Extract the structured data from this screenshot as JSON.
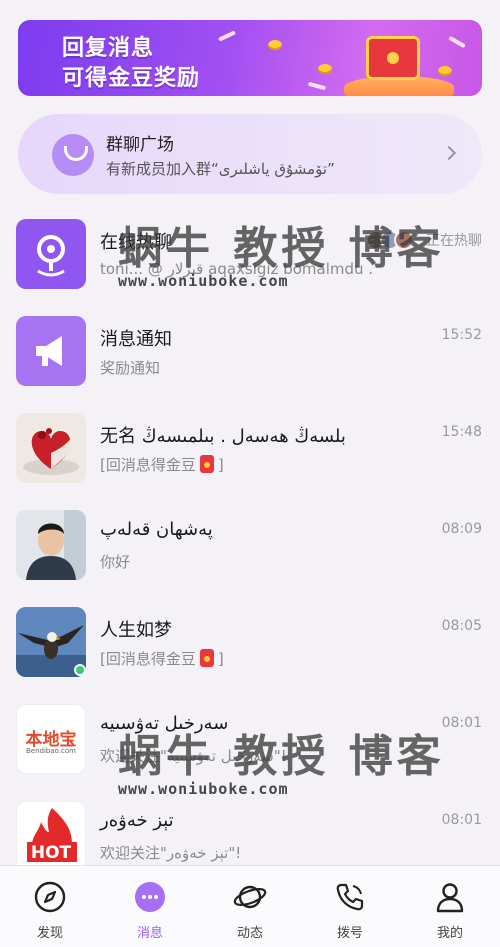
{
  "banner": {
    "line1": "回复消息",
    "line2": "可得金豆奖励"
  },
  "plaza": {
    "title": "群聊广场",
    "subtitle": "有新成员加入群“تۆمشۇق ياشلىرى”"
  },
  "chats": [
    {
      "title": "在线热聊",
      "subtitle": "toni... @ قىزلار aqaxsigiz bomalmdu .",
      "status": "正在热聊",
      "icon": "location-pin-icon",
      "color": "#8f57ef"
    },
    {
      "title": "消息通知",
      "subtitle": "奖励通知",
      "time": "15:52",
      "icon": "megaphone-icon",
      "color": "#a673f2"
    },
    {
      "title": "无名 بلسەڭ ھەسەل . بىلمىسەڭ",
      "subtitle": "[回消息得金豆",
      "subtitle_end": "]",
      "time": "15:48",
      "icon": "heart-cake-avatar"
    },
    {
      "title": "پەشھان قەلەپ",
      "subtitle": "你好",
      "time": "08:09",
      "icon": "man-portrait-avatar"
    },
    {
      "title": "人生如梦",
      "subtitle": "[回消息得金豆",
      "subtitle_end": "]",
      "time": "08:05",
      "icon": "eagle-avatar",
      "online": true
    },
    {
      "title": "سەرخىل تەۋسىيە",
      "subtitle": "欢迎关注\"سەرخىل تەۋسىيە\"!",
      "time": "08:01",
      "icon": "bendibao-logo-avatar",
      "logo_text": "本地宝",
      "logo_sub": "Bendibao.com"
    },
    {
      "title": "تېز خەۋەر",
      "subtitle": "欢迎关注\"تېز خەۋەر\"!",
      "time": "08:01",
      "icon": "hot-fire-avatar",
      "logo_text": "HOT"
    }
  ],
  "watermark": {
    "text": "蜗牛 教授 博客",
    "url": "www.woniuboke.com"
  },
  "nav": [
    {
      "label": "发现",
      "icon": "compass-icon"
    },
    {
      "label": "消息",
      "icon": "message-bubble-icon",
      "active": true
    },
    {
      "label": "动态",
      "icon": "planet-icon"
    },
    {
      "label": "拨号",
      "icon": "phone-icon"
    },
    {
      "label": "我的",
      "icon": "person-icon"
    }
  ],
  "colors": {
    "accent": "#9b5cf0",
    "background": "#f4f2f7",
    "online": "#3ccb74"
  }
}
